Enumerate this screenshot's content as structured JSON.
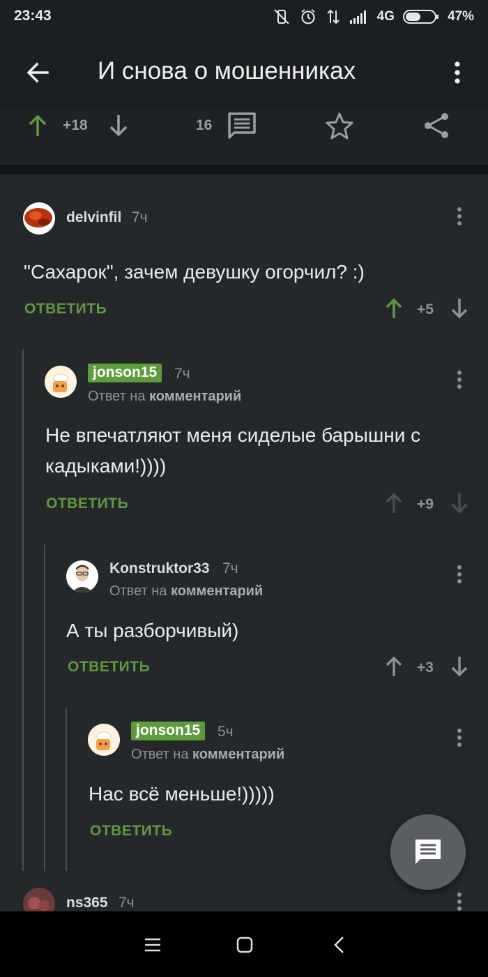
{
  "status_bar": {
    "time": "23:43",
    "network": "4G",
    "battery": "47%",
    "icons": [
      "vibrate-off-icon",
      "alarm-icon",
      "data-transfer-icon",
      "signal-icon",
      "battery-icon"
    ]
  },
  "app_bar": {
    "title": "И снова о мошенниках",
    "back_icon": "arrow-back-icon",
    "menu_icon": "more-vertical-icon"
  },
  "post_actions": {
    "rating": "+18",
    "comments_count": "16",
    "icons": [
      "upvote-icon",
      "downvote-icon",
      "comments-icon",
      "star-icon",
      "share-icon"
    ]
  },
  "comments": [
    {
      "author": "delvinfil",
      "time": "7ч",
      "text": "\"Сахарок\", зачем девушку огорчил? :)",
      "reply_label": "ОТВЕТИТЬ",
      "rating": "+5",
      "upvoted": true
    },
    {
      "author": "jonson15",
      "time": "7ч",
      "reply_to_prefix": "Ответ на",
      "reply_to_target": "комментарий",
      "text": "Не впечатляют меня сиделые барышни с кадыками!))))",
      "reply_label": "ОТВЕТИТЬ",
      "rating": "+9",
      "is_author": true
    },
    {
      "author": "Konstruktor33",
      "time": "7ч",
      "reply_to_prefix": "Ответ на",
      "reply_to_target": "комментарий",
      "text": "А ты разборчивый)",
      "reply_label": "ОТВЕТИТЬ",
      "rating": "+3"
    },
    {
      "author": "jonson15",
      "time": "5ч",
      "reply_to_prefix": "Ответ на",
      "reply_to_target": "комментарий",
      "text": "Нас всё меньше!)))))",
      "reply_label": "ОТВЕТИТЬ",
      "is_author": true
    },
    {
      "author": "ns365",
      "time": "7ч"
    }
  ],
  "colors": {
    "accent_green": "#5e9a3c",
    "background": "#25282b",
    "appbar": "#1c1f22"
  },
  "fab_icon": "comment-icon",
  "nav_bar": {
    "icons": [
      "menu-icon",
      "home-icon",
      "back-icon"
    ]
  }
}
